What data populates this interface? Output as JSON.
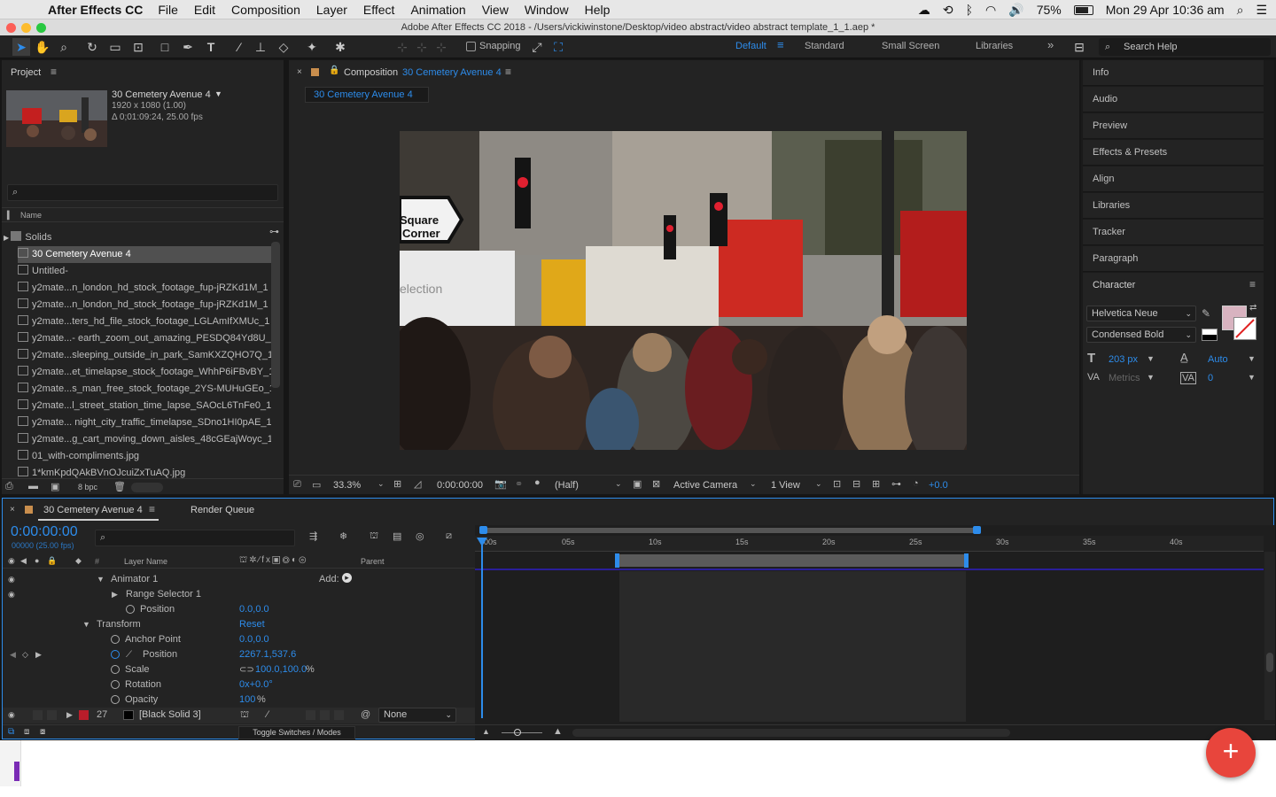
{
  "menubar": {
    "app_name": "After Effects CC",
    "items": [
      "File",
      "Edit",
      "Composition",
      "Layer",
      "Effect",
      "Animation",
      "View",
      "Window",
      "Help"
    ],
    "battery": "75%",
    "clock": "Mon 29 Apr  10:36 am"
  },
  "window_title": "Adobe After Effects CC 2018 - /Users/vickiwinstone/Desktop/video abstract/video abstract template_1_1.aep *",
  "toolbar": {
    "snapping_label": "Snapping",
    "workspaces": [
      "Default",
      "Standard",
      "Small Screen",
      "Libraries"
    ],
    "active_workspace": "Default",
    "search_placeholder": "Search Help"
  },
  "project_panel": {
    "title": "Project",
    "item_name": "30 Cemetery Avenue 4",
    "item_size": "1920 x 1080 (1.00)",
    "item_duration": "Δ 0;01:09:24, 25.00 fps",
    "column_name": "Name",
    "items": [
      {
        "name": "Solids",
        "type": "folder"
      },
      {
        "name": "30 Cemetery Avenue 4",
        "type": "comp",
        "selected": true
      },
      {
        "name": "Untitled-",
        "type": "comp"
      },
      {
        "name": "y2mate...n_london_hd_stock_footage_fup-jRZKd1M_1",
        "type": "file"
      },
      {
        "name": "y2mate...n_london_hd_stock_footage_fup-jRZKd1M_1",
        "type": "file"
      },
      {
        "name": "y2mate...ters_hd_file_stock_footage_LGLAmIfXMUc_1",
        "type": "file"
      },
      {
        "name": "y2mate...- earth_zoom_out_amazing_PESDQ84Yd8U_",
        "type": "file"
      },
      {
        "name": "y2mate...sleeping_outside_in_park_SamKXZQHO7Q_1",
        "type": "file"
      },
      {
        "name": "y2mate...et_timelapse_stock_footage_WhhP6iFBvBY_1",
        "type": "file"
      },
      {
        "name": "y2mate...s_man_free_stock_footage_2YS-MUHuGEo_1",
        "type": "file"
      },
      {
        "name": "y2mate...l_street_station_time_lapse_SAOcL6TnFe0_1",
        "type": "file"
      },
      {
        "name": "y2mate... night_city_traffic_timelapse_SDno1HI0pAE_1",
        "type": "file"
      },
      {
        "name": "y2mate...g_cart_moving_down_aisles_48cGEajWoyc_1",
        "type": "file"
      },
      {
        "name": "01_with-compliments.jpg",
        "type": "file"
      },
      {
        "name": "1*kmKpdQAkBVnOJcuiZxTuAQ.jpg",
        "type": "file"
      }
    ],
    "bpc": "8 bpc"
  },
  "composition_panel": {
    "label": "Composition",
    "comp_name": "30 Cemetery Avenue 4",
    "tab": "30 Cemetery Avenue 4",
    "zoom": "33.3%",
    "timecode": "0:00:00:00",
    "resolution": "(Half)",
    "camera": "Active Camera",
    "views": "1 View",
    "exposure": "+0.0",
    "sign_text_1": "Square",
    "sign_text_2": "Corner",
    "van_text": "election"
  },
  "right_panels": [
    "Info",
    "Audio",
    "Preview",
    "Effects & Presets",
    "Align",
    "Libraries",
    "Tracker",
    "Paragraph"
  ],
  "character": {
    "title": "Character",
    "font": "Helvetica Neue",
    "style": "Condensed Bold",
    "size": "203 px",
    "leading": "Auto",
    "kerning": "Metrics",
    "tracking": "0",
    "fill_color": "#d8b3c0"
  },
  "timeline": {
    "tab_comp": "30 Cemetery Avenue 4",
    "tab_render": "Render Queue",
    "timecode": "0:00:00:00",
    "frame_info": "00000 (25.00 fps)",
    "col_layer_name": "Layer Name",
    "col_parent": "Parent",
    "ruler": [
      "00s",
      "05s",
      "10s",
      "15s",
      "20s",
      "25s",
      "30s",
      "35s",
      "40s"
    ],
    "rows": {
      "animator": "Animator 1",
      "add": "Add:",
      "range_selector": "Range Selector 1",
      "position1_label": "Position",
      "position1_value": "0.0,0.0",
      "transform": "Transform",
      "reset": "Reset",
      "anchor_label": "Anchor Point",
      "anchor_value": "0.0,0.0",
      "position2_label": "Position",
      "position2_value": "2267.1,537.6",
      "scale_label": "Scale",
      "scale_value": "100.0,100.0",
      "scale_unit": "%",
      "rotation_label": "Rotation",
      "rotation_value": "0x+0.0°",
      "opacity_label": "Opacity",
      "opacity_value": "100",
      "opacity_unit": "%",
      "layer_number": "27",
      "layer_name": "[Black Solid 3]",
      "parent_value": "None"
    },
    "toggle_label": "Toggle Switches / Modes"
  },
  "colors": {
    "accent": "#2d8ceb",
    "panel": "#232323",
    "fab": "#e8453c"
  }
}
